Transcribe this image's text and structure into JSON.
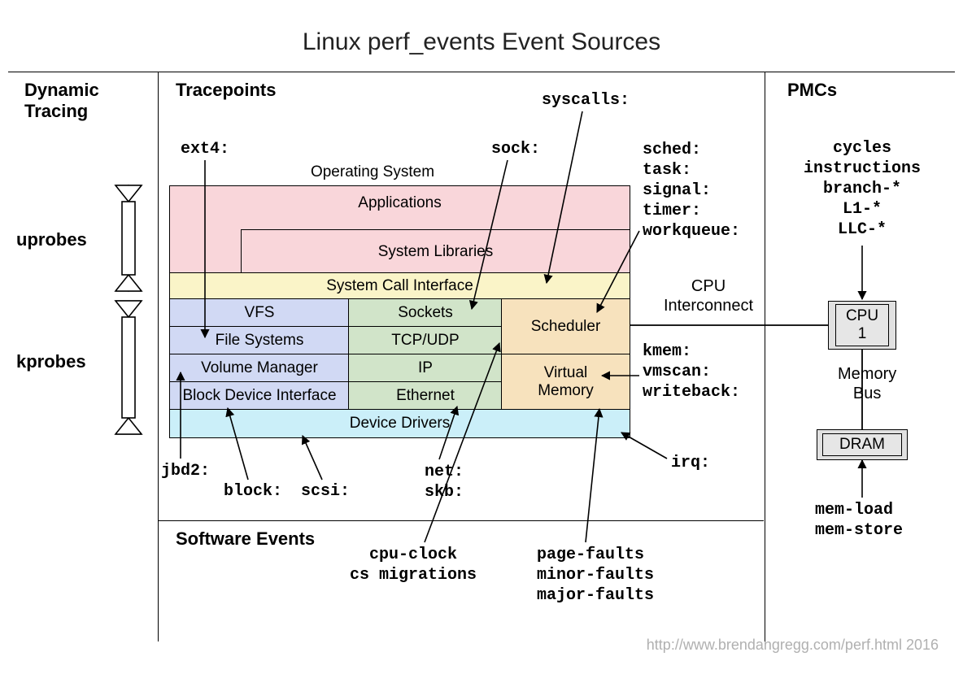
{
  "title": "Linux perf_events Event Sources",
  "headings": {
    "dynamic_tracing": "Dynamic\nTracing",
    "tracepoints": "Tracepoints",
    "pmcs": "PMCs",
    "software_events": "Software Events"
  },
  "dynamic_tracing": {
    "uprobes": "uprobes",
    "kprobes": "kprobes"
  },
  "os_layers": {
    "os": "Operating System",
    "applications": "Applications",
    "system_libraries": "System Libraries",
    "system_call_interface": "System Call Interface",
    "vfs": "VFS",
    "file_systems": "File Systems",
    "volume_manager": "Volume Manager",
    "block_device_interface": "Block Device Interface",
    "sockets": "Sockets",
    "tcp_udp": "TCP/UDP",
    "ip": "IP",
    "ethernet": "Ethernet",
    "scheduler": "Scheduler",
    "virtual_memory": "Virtual\nMemory",
    "device_drivers": "Device Drivers"
  },
  "tracepoint_labels": {
    "ext4": "ext4:",
    "sock": "sock:",
    "syscalls": "syscalls:",
    "sched_group": "sched:\ntask:\nsignal:\ntimer:\nworkqueue:",
    "kmem_group": "kmem:\nvmscan:\nwriteback:",
    "irq": "irq:",
    "jbd2": "jbd2:",
    "block": "block:",
    "scsi": "scsi:",
    "net_group": "net:\nskb:"
  },
  "software_events": {
    "cpu_group": "cpu-clock\ncs migrations",
    "fault_group": "page-faults\nminor-faults\nmajor-faults"
  },
  "interconnect": {
    "cpu_interconnect": "CPU\nInterconnect",
    "memory_bus": "Memory\nBus"
  },
  "hw": {
    "cpu": "CPU",
    "cpu_num": "1",
    "dram": "DRAM"
  },
  "pmc_labels": {
    "cpu_group": "cycles\ninstructions\nbranch-*\nL1-*\nLLC-*",
    "mem_group": "mem-load\nmem-store"
  },
  "attribution": "http://www.brendangregg.com/perf.html 2016"
}
